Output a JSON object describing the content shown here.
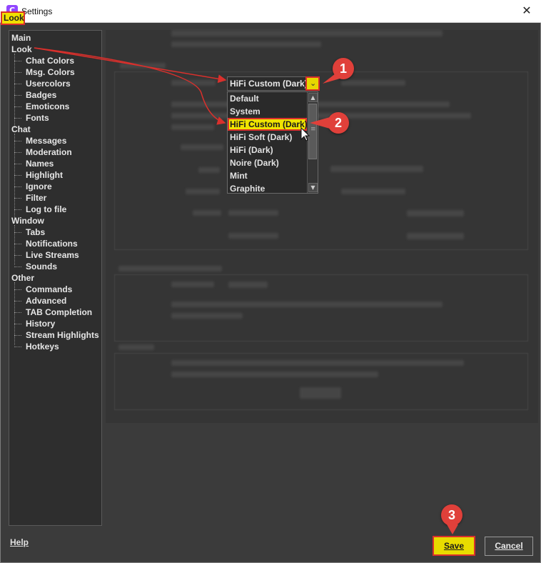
{
  "window": {
    "title": "Settings",
    "close_glyph": "✕",
    "app_icon_letter": "C",
    "icon_name": "chatterino-app-icon"
  },
  "tree": {
    "categories": [
      {
        "label": "Main",
        "children": []
      },
      {
        "label": "Look",
        "children": [
          "Chat Colors",
          "Msg. Colors",
          "Usercolors",
          "Badges",
          "Emoticons",
          "Fonts"
        ]
      },
      {
        "label": "Chat",
        "children": [
          "Messages",
          "Moderation",
          "Names",
          "Highlight",
          "Ignore",
          "Filter",
          "Log to file"
        ]
      },
      {
        "label": "Window",
        "children": [
          "Tabs",
          "Notifications",
          "Live Streams",
          "Sounds"
        ]
      },
      {
        "label": "Other",
        "children": [
          "Commands",
          "Advanced",
          "TAB Completion",
          "History",
          "Stream Highlights",
          "Hotkeys"
        ]
      }
    ],
    "selected": "Look"
  },
  "theme_combo": {
    "value": "HiFi Custom (Dark)",
    "arrow_glyph": "⌄",
    "options": [
      "Default",
      "System",
      "HiFi Custom (Dark)",
      "HiFi Soft (Dark)",
      "HiFi (Dark)",
      "Noire (Dark)",
      "Mint",
      "Graphite"
    ],
    "selected_index": 2
  },
  "scrollbar": {
    "up_glyph": "▲",
    "down_glyph": "▼",
    "grip_glyph": "≡"
  },
  "steps": [
    "1",
    "2",
    "3"
  ],
  "footer": {
    "help": "Help",
    "save": "Save",
    "cancel": "Cancel"
  },
  "colors": {
    "highlight": "#f0e400",
    "annotation_red": "#d9302c",
    "background": "#3b3b3b"
  }
}
